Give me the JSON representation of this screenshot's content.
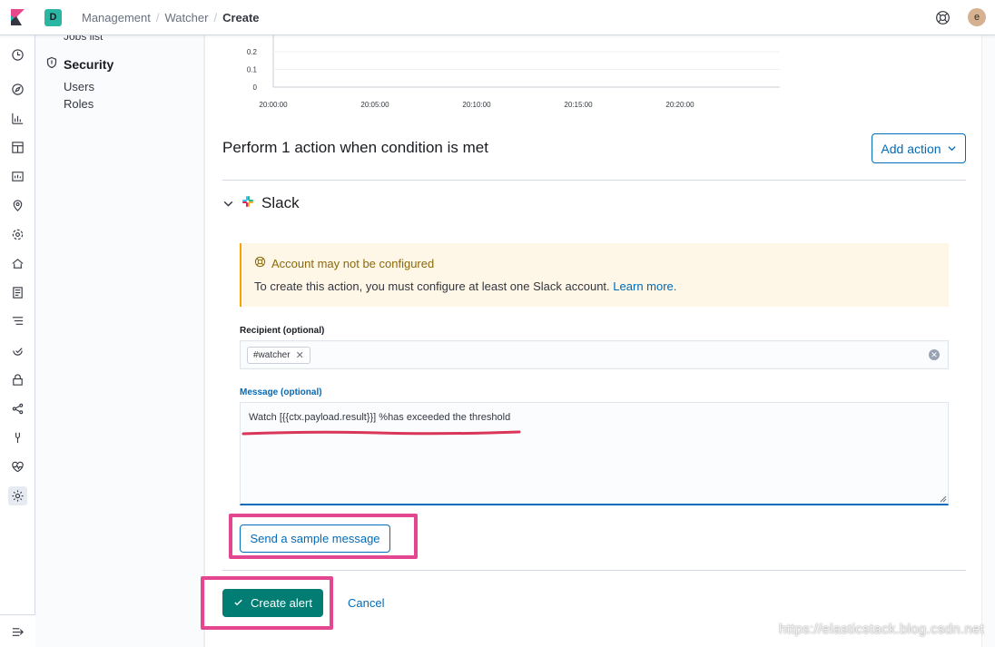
{
  "header": {
    "space_initial": "D",
    "breadcrumbs": [
      "Management",
      "Watcher",
      "Create"
    ],
    "user_initial": "e"
  },
  "rail": {
    "icons": [
      "clock-icon",
      "compass-icon",
      "visualize-icon",
      "dashboard-icon",
      "canvas-icon",
      "maps-icon",
      "ml-icon",
      "infrastructure-icon",
      "logs-icon",
      "apm-icon",
      "uptime-icon",
      "siem-icon",
      "graph-icon",
      "dev-tools-icon",
      "monitoring-icon",
      "management-icon"
    ],
    "active": "management-icon"
  },
  "sidebar": {
    "truncated_item": "Jobs list",
    "section_title": "Security",
    "items": [
      "Users",
      "Roles"
    ]
  },
  "chart_data": {
    "type": "line",
    "y_ticks": [
      "0.2",
      "0.1",
      "0"
    ],
    "x_ticks": [
      "20:00:00",
      "20:05:00",
      "20:10:00",
      "20:15:00",
      "20:20:00"
    ],
    "grid": true
  },
  "actions": {
    "title": "Perform 1 action when condition is met",
    "add_action_label": "Add action"
  },
  "slack": {
    "title": "Slack",
    "callout_title": "Account may not be configured",
    "callout_body": "To create this action, you must configure at least one Slack account.",
    "callout_link": "Learn more.",
    "recipient_label": "Recipient (optional)",
    "recipients": [
      "#watcher"
    ],
    "message_label": "Message (optional)",
    "message_value": "Watch [{{ctx.payload.result}}] %has exceeded the threshold",
    "sample_button": "Send a sample message"
  },
  "footer": {
    "create_label": "Create alert",
    "cancel_label": "Cancel"
  },
  "watermark": "https://elasticstack.blog.csdn.net",
  "colors": {
    "primary": "#006bb8",
    "success": "#017d73",
    "warning_bg": "#fef6e6",
    "highlight": "#e4468f"
  }
}
